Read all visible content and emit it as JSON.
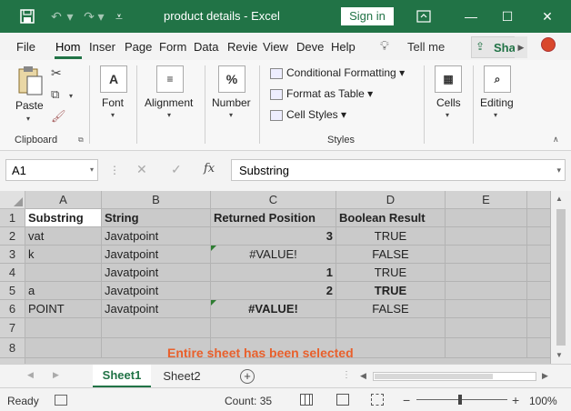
{
  "window": {
    "title": "product details  -  Excel",
    "sign_in": "Sign in",
    "close_glyph": "✕",
    "minimize_glyph": "—",
    "maximize_glyph": "☐"
  },
  "tabs": [
    "File",
    "Hom",
    "Inser",
    "Page",
    "Form",
    "Data",
    "Revie",
    "View",
    "Deve",
    "Help"
  ],
  "tell_me": "Tell me",
  "share": "Shar",
  "ribbon": {
    "clipboard": {
      "paste": "Paste",
      "group": "Clipboard"
    },
    "font": {
      "label": "Font",
      "icon": "A"
    },
    "alignment": {
      "label": "Alignment"
    },
    "number": {
      "label": "Number",
      "icon": "%"
    },
    "styles": {
      "conditional": "Conditional Formatting",
      "format_table": "Format as Table",
      "cell_styles": "Cell Styles",
      "group": "Styles"
    },
    "cells": {
      "label": "Cells"
    },
    "editing": {
      "label": "Editing"
    }
  },
  "formula_bar": {
    "name_box": "A1",
    "fx": "fx",
    "value": "Substring"
  },
  "columns": [
    "A",
    "B",
    "C",
    "D",
    "E"
  ],
  "rows": [
    "1",
    "2",
    "3",
    "4",
    "5",
    "6",
    "7",
    "8"
  ],
  "cells": [
    [
      "Substring",
      "String",
      "Returned Position",
      "Boolean Result",
      ""
    ],
    [
      "vat",
      "Javatpoint",
      "3",
      "TRUE",
      ""
    ],
    [
      "k",
      "Javatpoint",
      "#VALUE!",
      "FALSE",
      ""
    ],
    [
      "",
      "Javatpoint",
      "1",
      "TRUE",
      ""
    ],
    [
      "a",
      "Javatpoint",
      "2",
      "TRUE",
      ""
    ],
    [
      "POINT",
      "Javatpoint",
      "#VALUE!",
      "FALSE",
      ""
    ],
    [
      "",
      "",
      "",
      "",
      ""
    ],
    [
      "",
      "",
      "",
      "",
      ""
    ]
  ],
  "annotation": "Entire sheet has been selected",
  "sheets": [
    "Sheet1",
    "Sheet2"
  ],
  "add_sheet": "+",
  "status": {
    "ready": "Ready",
    "count": "Count: 35",
    "zoom": "100%",
    "zoom_minus": "−",
    "zoom_plus": "+"
  }
}
